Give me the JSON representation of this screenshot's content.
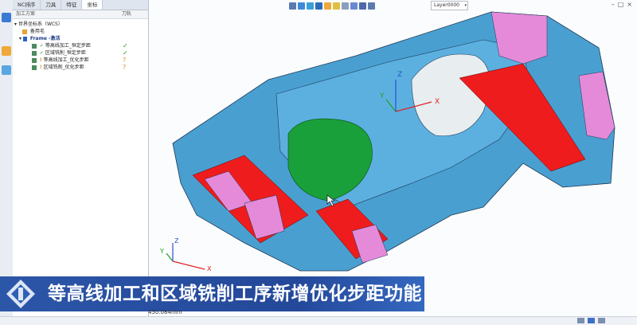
{
  "panel": {
    "tabs": [
      "NC排序",
      "刀具",
      "特征",
      "坐标"
    ],
    "active_tab": 3,
    "col_plan": "加工方案",
    "col_path": "刀轨",
    "tree": {
      "wcs": "世界坐标系（WCS）",
      "stock": "备用毛",
      "frame": "Frame -激活",
      "ops": [
        {
          "label": "等高线加工_恒定步距",
          "status": "✓"
        },
        {
          "label": "区域铣削_恒定步距",
          "status": "✓"
        },
        {
          "label": "等高线加工_优化步距",
          "status": "?"
        },
        {
          "label": "区域铣削_优化步距",
          "status": "?"
        }
      ]
    }
  },
  "toolbar": {
    "layer": "Layer0000",
    "window_controls": [
      "–",
      "□",
      "×"
    ]
  },
  "banner": {
    "text": "等高线加工和区域铣削工序新增优化步距功能"
  },
  "status": {
    "coord": "450.084mm"
  },
  "axes": {
    "x": "X",
    "y": "Y",
    "z": "Z"
  },
  "colors": {
    "model_blue": "#4a9fd1",
    "pocket_red": "#ee1c1c",
    "wall_pink": "#e58ad8",
    "surface_green": "#1aa03a",
    "banner_blue": "#24489a"
  }
}
